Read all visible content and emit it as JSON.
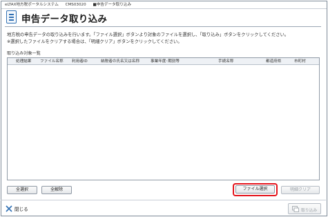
{
  "window": {
    "app_name": "eLTAX地方税ポータルシステム",
    "screen_code": "CMS03020",
    "screen_name": "■申告データ取り込み"
  },
  "header": {
    "title": "申告データ取り込み"
  },
  "description": {
    "line1": "地方税の申告データの取り込みを行います。「ファイル選択」ボタンより対象のファイルを選択し、「取り込み」ボタンをクリックしてください。",
    "line2": "※選択したファイルをクリアする場合は、「明細クリア」ボタンをクリックしてください。"
  },
  "table": {
    "section_label": "取り込み対象一覧",
    "columns": [
      "処理結果",
      "ファイル名称",
      "利用者ID",
      "納税者の氏名又は名称",
      "事業年度･期別等",
      "手続名称",
      "都道府県",
      "市町村"
    ],
    "rows": []
  },
  "buttons": {
    "select_all": "全選択",
    "deselect_all": "全解除",
    "file_select": "ファイル選択",
    "clear_details": "明細クリア",
    "close": "閉じる",
    "import": "取り込み"
  },
  "colors": {
    "highlight": "#e4131b",
    "accent": "#2f6fb3"
  }
}
